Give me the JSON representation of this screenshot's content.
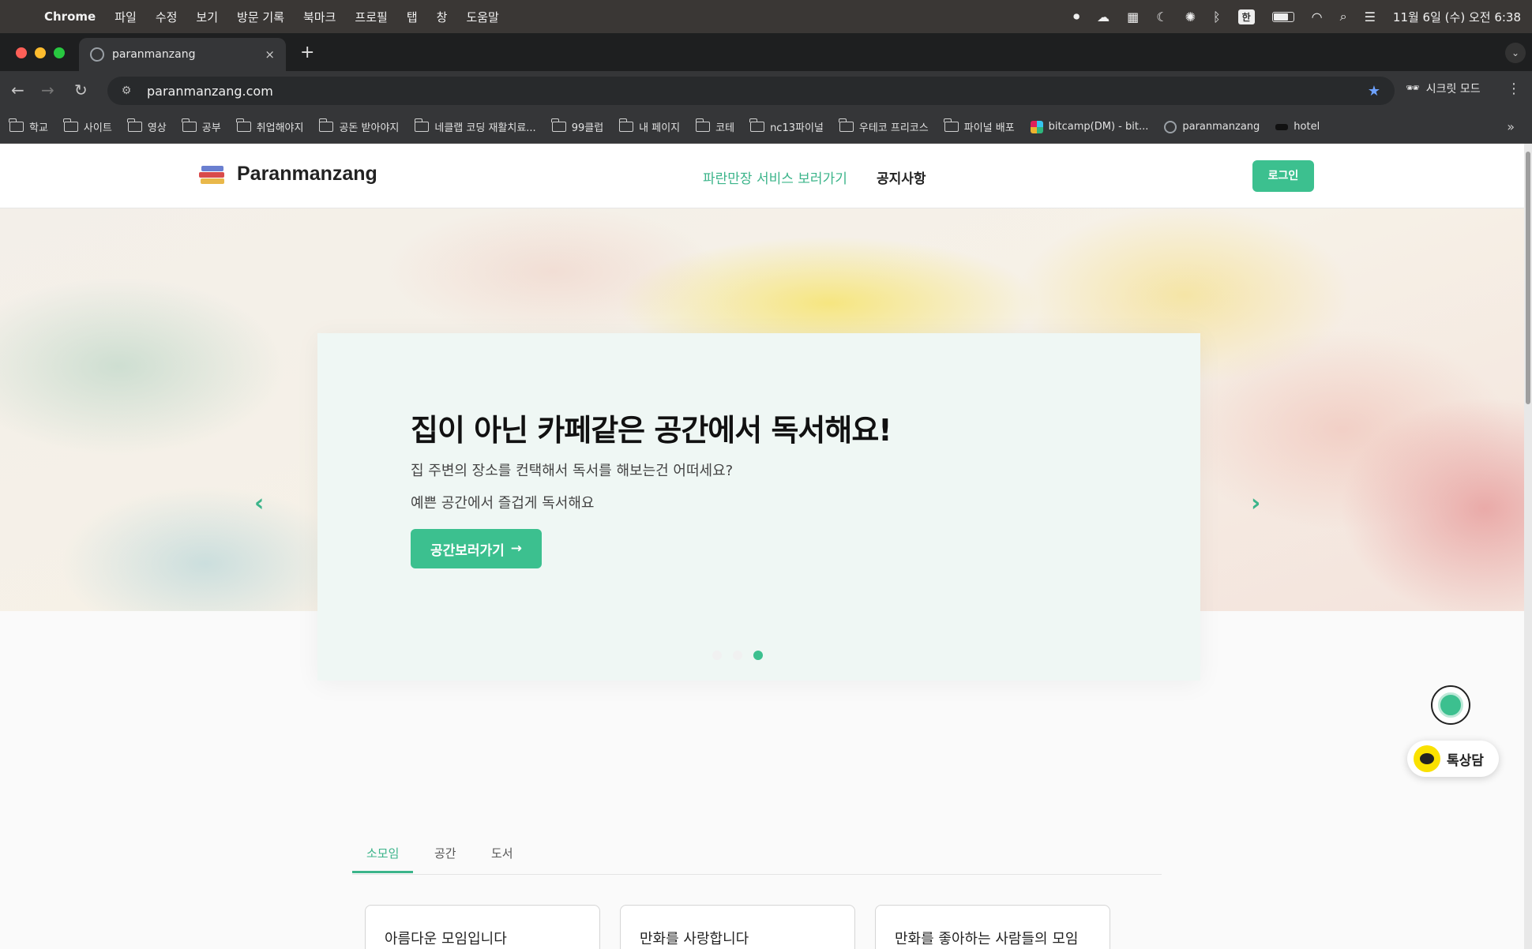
{
  "menubar": {
    "app": "Chrome",
    "items": [
      "파일",
      "수정",
      "보기",
      "방문 기록",
      "북마크",
      "프로필",
      "탭",
      "창",
      "도움말"
    ],
    "input_lang": "한",
    "datetime": "11월 6일 (수) 오전 6:38"
  },
  "browser": {
    "tab_title": "paranmanzang",
    "url": "paranmanzang.com",
    "incognito_label": "시크릿 모드",
    "bookmarks": [
      {
        "label": "학교",
        "type": "folder"
      },
      {
        "label": "사이트",
        "type": "folder"
      },
      {
        "label": "영상",
        "type": "folder"
      },
      {
        "label": "공부",
        "type": "folder"
      },
      {
        "label": "취업해야지",
        "type": "folder"
      },
      {
        "label": "공돈 받아야지",
        "type": "folder"
      },
      {
        "label": "네클랩 코딩 재활치료...",
        "type": "folder"
      },
      {
        "label": "99클럽",
        "type": "folder"
      },
      {
        "label": "내 페이지",
        "type": "folder"
      },
      {
        "label": "코테",
        "type": "folder"
      },
      {
        "label": "nc13파이널",
        "type": "folder"
      },
      {
        "label": "우테코 프리코스",
        "type": "folder"
      },
      {
        "label": "파이널 배포",
        "type": "folder"
      },
      {
        "label": "bitcamp(DM) - bit...",
        "type": "slack"
      },
      {
        "label": "paranmanzang",
        "type": "globe"
      },
      {
        "label": "hotel",
        "type": "mask"
      }
    ]
  },
  "site": {
    "logo": "Paranmanzang",
    "nav": {
      "services": "파란만장 서비스 보러가기",
      "notice": "공지사항"
    },
    "login": "로그인",
    "hero": {
      "title": "집이 아닌 카페같은 공간에서 독서해요!",
      "subtitle1": "집 주변의 장소를 컨택해서 독서를 해보는건 어떠세요?",
      "subtitle2": "예쁜 공간에서 즐겁게 독서해요",
      "button": "공간보러가기",
      "button_arrow": "→",
      "slides": 3,
      "active_slide": 3
    },
    "tabs": [
      "소모임",
      "공간",
      "도서"
    ],
    "active_tab": "소모임",
    "cards": [
      "아름다운 모임입니다",
      "만화를 사랑합니다",
      "만화를 좋아하는 사람들의 모임"
    ],
    "chat_label": "톡상담"
  },
  "colors": {
    "accent": "#3cc08f",
    "accent_text": "#3bb48a",
    "hero_card": "#eff7f4",
    "kakao": "#fae100"
  },
  "icons": {
    "prev": "‹",
    "next": "›",
    "back": "←",
    "forward": "→",
    "reload": "↻",
    "star": "★",
    "close": "×",
    "plus": "+",
    "more": "»",
    "kebab": "⋮"
  }
}
